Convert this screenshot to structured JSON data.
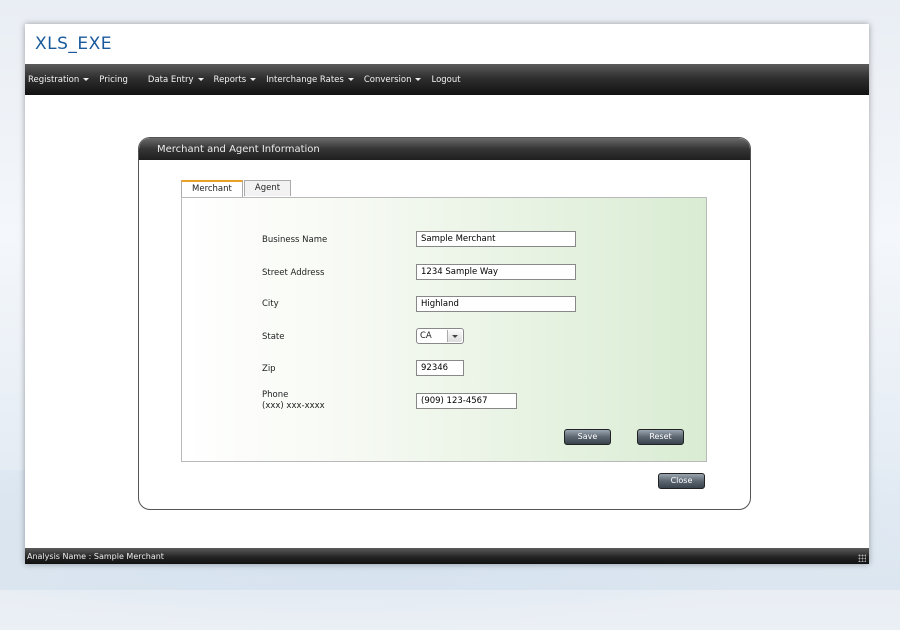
{
  "app": {
    "title": "XLS_EXE"
  },
  "menu": [
    {
      "label": "Registration",
      "dropdown": true
    },
    {
      "label": "Pricing",
      "dropdown": false
    },
    {
      "label": "Data Entry",
      "dropdown": true
    },
    {
      "label": "Reports",
      "dropdown": true
    },
    {
      "label": "Interchange Rates",
      "dropdown": true
    },
    {
      "label": "Conversion",
      "dropdown": true
    },
    {
      "label": "Logout",
      "dropdown": false
    }
  ],
  "panel": {
    "title": "Merchant and Agent Information",
    "tabs": [
      {
        "label": "Merchant",
        "active": true
      },
      {
        "label": "Agent",
        "active": false
      }
    ],
    "form": {
      "business_name": {
        "label": "Business Name",
        "value": "Sample Merchant"
      },
      "street_address": {
        "label": "Street Address",
        "value": "1234 Sample Way"
      },
      "city": {
        "label": "City",
        "value": "Highland"
      },
      "state": {
        "label": "State",
        "value": "CA"
      },
      "zip": {
        "label": "Zip",
        "value": "92346"
      },
      "phone": {
        "label": "Phone",
        "hint": "(xxx) xxx-xxxx",
        "value": "(909) 123-4567"
      }
    },
    "buttons": {
      "save": "Save",
      "reset": "Reset",
      "close": "Close"
    }
  },
  "status": {
    "text": "Analysis Name : Sample Merchant"
  },
  "colors": {
    "title_blue": "#1a5a9c",
    "tab_accent": "#e6a126",
    "menubar": "#2f2f2f"
  }
}
